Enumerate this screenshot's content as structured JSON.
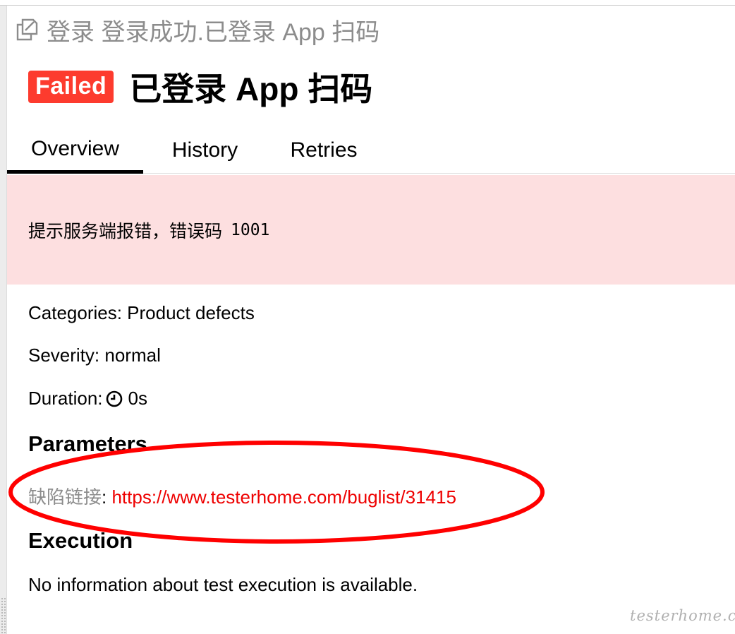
{
  "breadcrumb": {
    "icon": "copy-icon",
    "text": "登录 登录成功.已登录 App 扫码"
  },
  "header": {
    "status": "Failed",
    "title": "已登录 App 扫码"
  },
  "tabs": [
    {
      "label": "Overview",
      "active": true
    },
    {
      "label": "History",
      "active": false
    },
    {
      "label": "Retries",
      "active": false
    }
  ],
  "error": {
    "message": "提示服务端报错，错误码",
    "code": "1001"
  },
  "info": {
    "categories": "Categories: Product defects",
    "severity": "Severity: normal",
    "duration_label": "Duration:",
    "duration_icon": "clock-icon",
    "duration_value": "0s"
  },
  "parameters": {
    "title": "Parameters",
    "items": [
      {
        "name": "缺陷链接",
        "value": "https://www.testerhome.com/buglist/31415"
      }
    ]
  },
  "execution": {
    "title": "Execution",
    "text": "No information about test execution is available."
  },
  "watermark": "testerhome.com",
  "colors": {
    "badge_failed": "#fd3b2e",
    "error_bg": "#fddfe0",
    "link": "#ee0000",
    "annotation": "#ff0000",
    "muted": "#8c8c8c"
  }
}
